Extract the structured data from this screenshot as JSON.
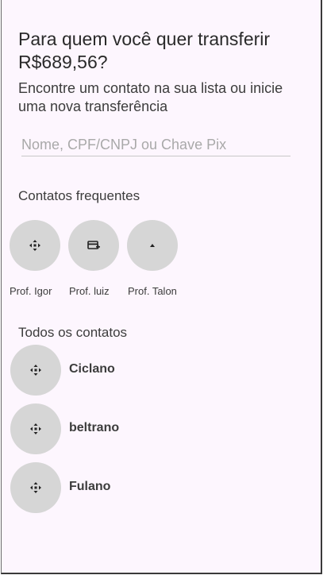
{
  "header": {
    "title": "Para quem você quer transferir R$689,56?",
    "subtitle": "Encontre um contato na sua lista ou inicie uma nova transferência"
  },
  "search": {
    "placeholder": "Nome, CPF/CNPJ ou Chave Pix",
    "value": ""
  },
  "frequent": {
    "label": "Contatos frequentes",
    "items": [
      {
        "name": "Prof. Igor",
        "icon": "move-arrows-icon"
      },
      {
        "name": "Prof. luiz",
        "icon": "card-add-icon"
      },
      {
        "name": "Prof. Talon",
        "icon": "caret-up-icon"
      }
    ]
  },
  "all": {
    "label": "Todos os contatos",
    "items": [
      {
        "name": "Ciclano",
        "icon": "move-arrows-icon"
      },
      {
        "name": "beltrano",
        "icon": "move-arrows-icon"
      },
      {
        "name": "Fulano",
        "icon": "move-arrows-icon"
      }
    ]
  },
  "colors": {
    "background": "#fdf6fe",
    "avatar": "#d6d6d6",
    "text": "#3c3c3c"
  }
}
